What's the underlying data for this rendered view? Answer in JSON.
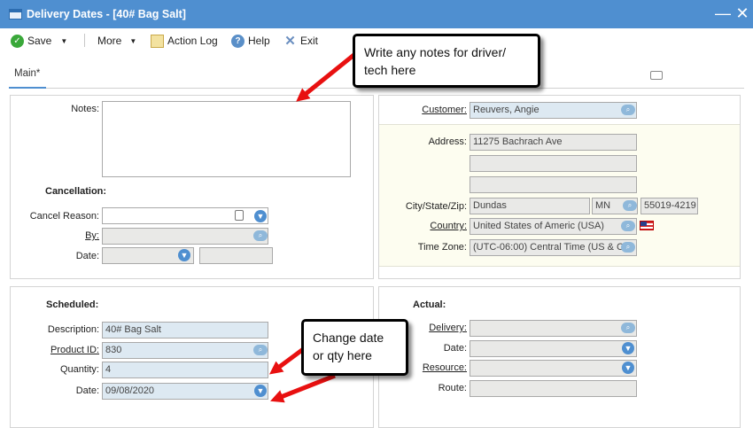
{
  "window": {
    "title": "Delivery Dates - [40# Bag Salt]",
    "min_glyph": "—",
    "close_glyph": "✕"
  },
  "toolbar": {
    "save_label": "Save",
    "more_label": "More",
    "action_log_label": "Action Log",
    "help_label": "Help",
    "exit_label": "Exit",
    "dropdown_glyph": "▼"
  },
  "tabs": {
    "main_label": "Main*"
  },
  "notes_section": {
    "notes_label": "Notes:",
    "notes_value": "",
    "cancellation_heading": "Cancellation:",
    "cancel_reason_label": "Cancel Reason:",
    "cancel_reason_value": "",
    "by_label": "By:",
    "by_value": "",
    "date_label": "Date:",
    "date_value": "",
    "time_value": ""
  },
  "customer_section": {
    "customer_label": "Customer:",
    "customer_value": "Reuvers, Angie",
    "address_label": "Address:",
    "address_line1": "11275 Bachrach Ave",
    "address_line2": "",
    "address_line3": "",
    "city_state_zip_label": "City/State/Zip:",
    "city_value": "Dundas",
    "state_value": "MN",
    "zip_value": "55019-4219",
    "country_label": "Country:",
    "country_value": "United States of Americ (USA)",
    "timezone_label": "Time Zone:",
    "timezone_value": "(UTC-06:00) Central Time (US & C"
  },
  "scheduled_section": {
    "heading": "Scheduled:",
    "description_label": "Description:",
    "description_value": "40# Bag Salt",
    "product_id_label": "Product ID:",
    "product_id_value": "830",
    "quantity_label": "Quantity:",
    "quantity_value": "4",
    "date_label": "Date:",
    "date_value": "09/08/2020"
  },
  "actual_section": {
    "heading": "Actual:",
    "delivery_label": "Delivery:",
    "delivery_value": "",
    "date_label": "Date:",
    "date_value": "",
    "resource_label": "Resource:",
    "resource_value": "",
    "route_label": "Route:",
    "route_value": ""
  },
  "callouts": {
    "notes_line1": "Write any notes for driver/",
    "notes_line2": "tech here",
    "change_line1": "Change date",
    "change_line2": "or qty here"
  },
  "colors": {
    "titlebar": "#4f8fd0",
    "arrow": "#e81010",
    "field_blue": "#dde9f2",
    "address_bg": "#fdfdf0"
  }
}
